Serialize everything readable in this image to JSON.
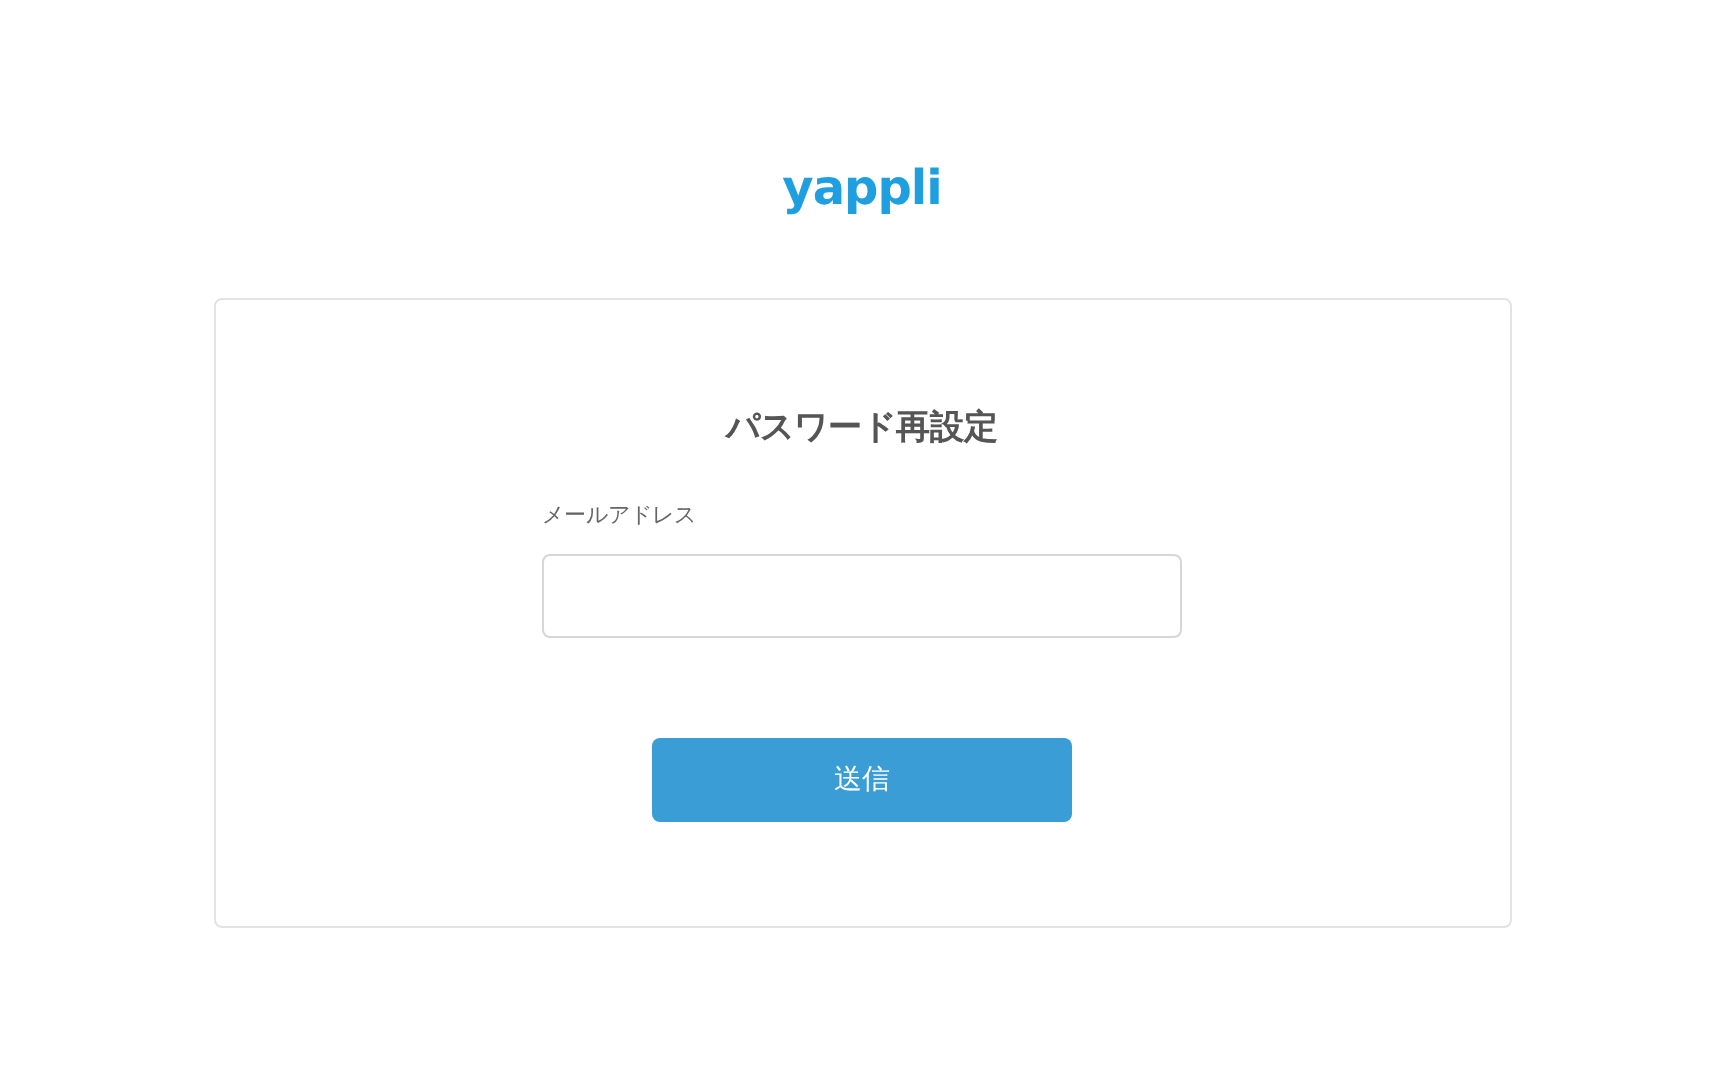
{
  "logo": "yappli",
  "form": {
    "title": "パスワード再設定",
    "email_label": "メールアドレス",
    "submit": "送信"
  }
}
